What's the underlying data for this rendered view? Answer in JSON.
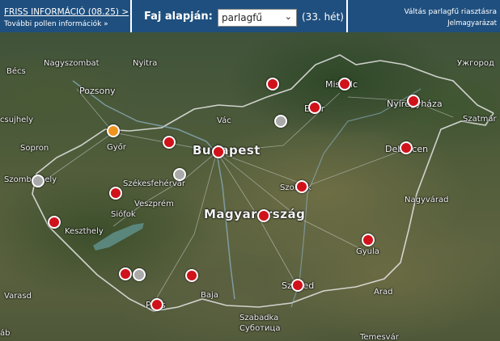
{
  "header": {
    "friss_label": "FRISS INFORMÁCIÓ (08.25) >",
    "tovabbi_label": "További pollen információk »",
    "faj_label": "Faj alapján:",
    "selected_species": "parlagfű",
    "week_label": "(33. hét)",
    "valtas_label": "Váltás parlagfű riasztásra",
    "jelmagyarazat_label": "Jelmagyarázat"
  },
  "colors": {
    "header_bg": "#1f4f7e",
    "high": "#d0121b",
    "medium": "#f0921e",
    "nodata": "#a9a9a9"
  },
  "map": {
    "labels": [
      {
        "text": "Bécs"
      },
      {
        "text": "Nagyszombat"
      },
      {
        "text": "Nyitra"
      },
      {
        "text": "Pozsony"
      },
      {
        "text": "Miskolc"
      },
      {
        "text": "Nyíregyháza"
      },
      {
        "text": "Ужгород"
      },
      {
        "text": "Szatmár"
      },
      {
        "text": "csujhely"
      },
      {
        "text": "Győr"
      },
      {
        "text": "Vác"
      },
      {
        "text": "Budapest"
      },
      {
        "text": "Eger"
      },
      {
        "text": "Debrecen"
      },
      {
        "text": "Sopron"
      },
      {
        "text": "Szombathely"
      },
      {
        "text": "Székesfehérvár"
      },
      {
        "text": "Szolnok"
      },
      {
        "text": "Veszprém"
      },
      {
        "text": "Nagyvárad"
      },
      {
        "text": "Siófok"
      },
      {
        "text": "Magyarország"
      },
      {
        "text": "Keszthely"
      },
      {
        "text": "Gyula"
      },
      {
        "text": "Szeged"
      },
      {
        "text": "Baja"
      },
      {
        "text": "Pécs"
      },
      {
        "text": "Arad"
      },
      {
        "text": "Varasd"
      },
      {
        "text": "Szabadka"
      },
      {
        "text": "Суботица"
      },
      {
        "text": "Temesvár"
      },
      {
        "text": "áb"
      }
    ],
    "stations": [
      {
        "level": "high"
      },
      {
        "level": "high"
      },
      {
        "level": "high"
      },
      {
        "level": "high"
      },
      {
        "level": "nodata"
      },
      {
        "level": "medium"
      },
      {
        "level": "high"
      },
      {
        "level": "high"
      },
      {
        "level": "high"
      },
      {
        "level": "nodata"
      },
      {
        "level": "nodata"
      },
      {
        "level": "high"
      },
      {
        "level": "high"
      },
      {
        "level": "high"
      },
      {
        "level": "high"
      },
      {
        "level": "high"
      },
      {
        "level": "high"
      },
      {
        "level": "nodata"
      },
      {
        "level": "high"
      },
      {
        "level": "high"
      },
      {
        "level": "high"
      }
    ]
  }
}
